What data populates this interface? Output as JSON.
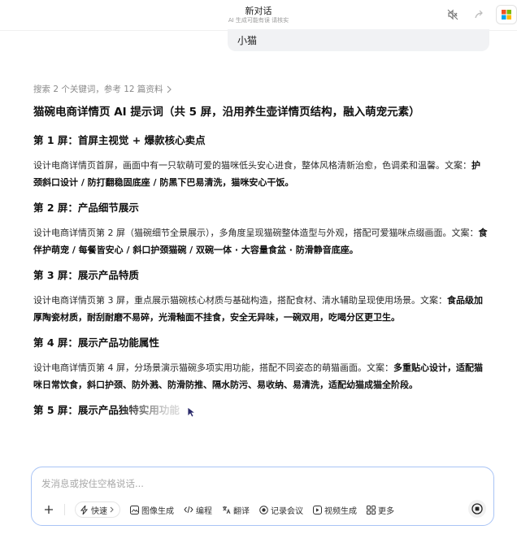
{
  "header": {
    "title": "新对话",
    "subtitle": "AI 生成可能有误 请核实"
  },
  "user_message": "小猫",
  "search_meta": "搜索 2 个关键词，参考 12 篇资料",
  "answer": {
    "title": "猫碗电商详情页 AI 提示词（共 5 屏，沿用养生壶详情页结构，融入萌宠元素）",
    "screens": [
      {
        "heading": "第 1 屏：首屏主视觉 + 爆款核心卖点",
        "desc": "设计电商详情页首屏，画面中有一只软萌可爱的猫咪低头安心进食，整体风格清新治愈，色调柔和温馨。文案：",
        "copy": "护颈斜口设计 / 防打翻稳固底座 / 防黑下巴易清洗，猫咪安心干饭。"
      },
      {
        "heading": "第 2 屏：产品细节展示",
        "desc": "设计电商详情页第 2 屏（猫碗细节全景展示），多角度呈现猫碗整体造型与外观，搭配可爱猫咪点缀画面。文案：",
        "copy": "食伴护萌宠 / 每餐皆安心 / 斜口护颈猫碗 / 双碗一体 · 大容量食盆 · 防滑静音底座。"
      },
      {
        "heading": "第 3 屏：展示产品特质",
        "desc": "设计电商详情页第 3 屏，重点展示猫碗核心材质与基础构造，搭配食材、清水辅助呈现使用场景。文案：",
        "copy": "食品级加厚陶瓷材质，耐刮耐磨不易碎，光滑釉面不挂食，安全无异味，一碗双用，吃喝分区更卫生。"
      },
      {
        "heading": "第 4 屏：展示产品功能属性",
        "desc": "设计电商详情页第 4 屏，分场景演示猫碗多项实用功能，搭配不同姿态的萌猫画面。文案：",
        "copy": "多重贴心设计，适配猫咪日常饮食，斜口护颈、防外溅、防滑防推、隔水防污、易收纳、易清洗，适配幼猫成猫全阶段。"
      },
      {
        "heading": "第 5 屏：展示产品独特实用功能",
        "desc": "",
        "copy": ""
      }
    ]
  },
  "composer": {
    "placeholder": "发消息或按住空格说话...",
    "tools": {
      "quick": "快速",
      "image": "图像生成",
      "code": "编程",
      "translate": "翻译",
      "meeting": "记录会议",
      "video": "视频生成",
      "more": "更多"
    }
  },
  "icons": {
    "mute": "speaker-off-icon",
    "share": "share-icon",
    "app": "app-logo-icon",
    "chevron": "chevron-right-icon"
  },
  "colors": {
    "composer_border": "#a9c4f5",
    "bubble_bg": "#f1f2f4"
  }
}
